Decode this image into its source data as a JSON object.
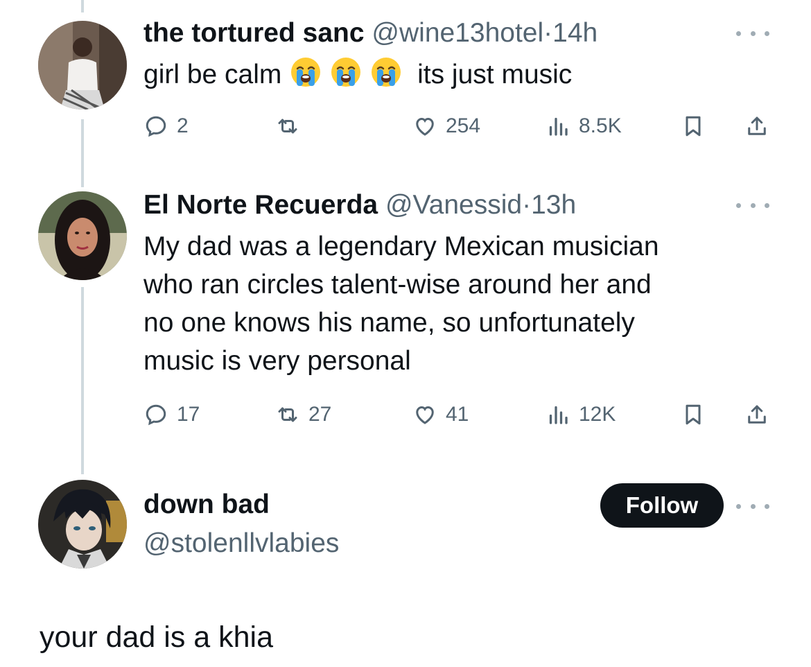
{
  "replies": [
    {
      "display_name": "the tortured sanc",
      "handle": "@wine13hotel",
      "time": "14h",
      "text": "its just music",
      "leading_text": "girl be calm",
      "emoji_count": 3,
      "stats": {
        "replies": "2",
        "reposts": "",
        "likes": "254",
        "views": "8.5K"
      }
    },
    {
      "display_name": "El Norte Recuerda",
      "handle": "@Vanessid",
      "time": "13h",
      "text_lines": [
        "My dad was a legendary Mexican musician",
        "who ran circles talent-wise around her and",
        "no one knows his name, so unfortunately",
        "music is very personal"
      ],
      "stats": {
        "replies": "17",
        "reposts": "27",
        "likes": "41",
        "views": "12K"
      }
    }
  ],
  "profile": {
    "display_name": "down bad",
    "handle": "@stolenllvlabies",
    "follow_label": "Follow"
  },
  "main_post": {
    "text": "your dad is a khia"
  },
  "separator": "·",
  "colors": {
    "text": "#0f1419",
    "secondary": "#536471",
    "thread_line": "#cfd9de",
    "button_bg": "#0f1419"
  }
}
